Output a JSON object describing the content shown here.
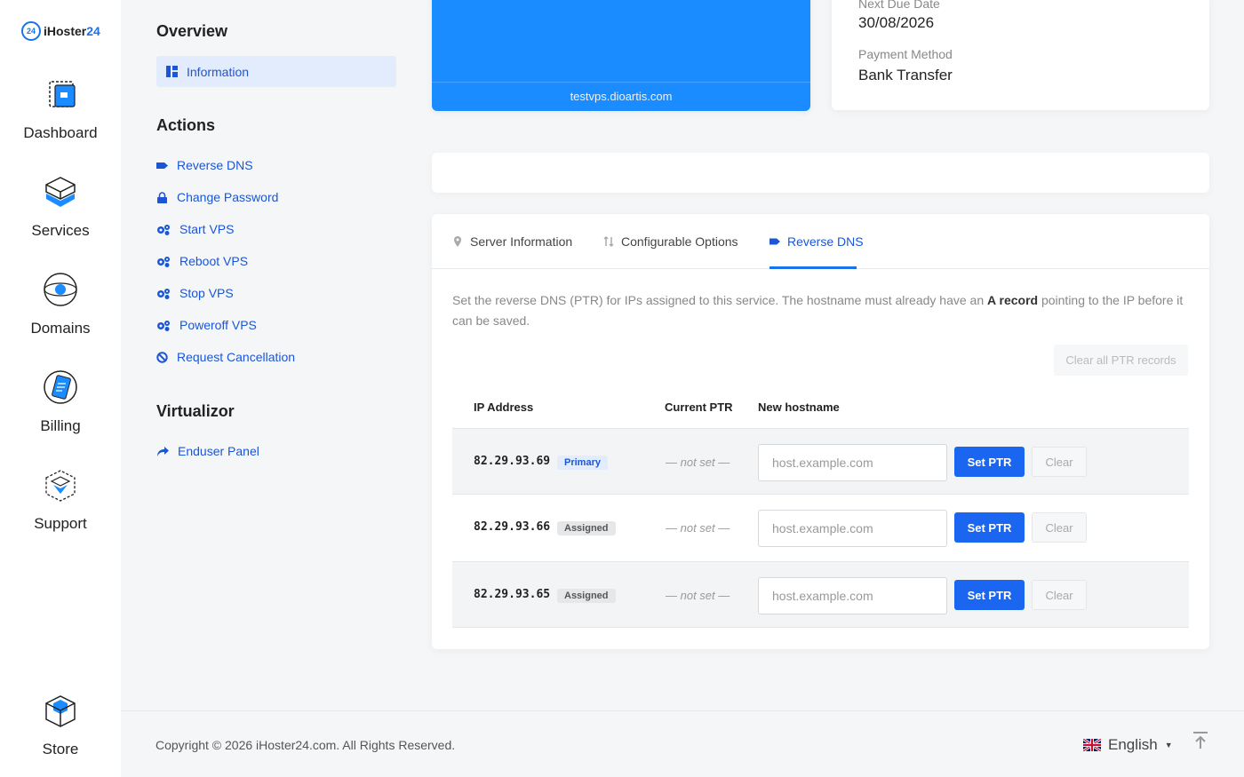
{
  "brand": {
    "badge": "24",
    "name_prefix": "iHoster",
    "name_suffix": "24"
  },
  "rail": {
    "items": [
      {
        "label": "Dashboard",
        "icon": "dashboard-icon"
      },
      {
        "label": "Services",
        "icon": "services-icon"
      },
      {
        "label": "Domains",
        "icon": "domains-icon"
      },
      {
        "label": "Billing",
        "icon": "billing-icon"
      },
      {
        "label": "Support",
        "icon": "support-icon"
      },
      {
        "label": "Store",
        "icon": "store-icon"
      }
    ]
  },
  "subnav": {
    "overview_title": "Overview",
    "information_label": "Information",
    "actions_title": "Actions",
    "actions": [
      {
        "label": "Reverse DNS",
        "icon": "tag-icon"
      },
      {
        "label": "Change Password",
        "icon": "lock-icon"
      },
      {
        "label": "Start VPS",
        "icon": "gears-icon"
      },
      {
        "label": "Reboot VPS",
        "icon": "gears-icon"
      },
      {
        "label": "Stop VPS",
        "icon": "gears-icon"
      },
      {
        "label": "Poweroff VPS",
        "icon": "gears-icon"
      },
      {
        "label": "Request Cancellation",
        "icon": "ban-icon"
      }
    ],
    "virtualizor_title": "Virtualizor",
    "enduser_label": "Enduser Panel"
  },
  "product_card": {
    "hostname": "testvps.dioartis.com"
  },
  "info_card": {
    "next_due_label": "Next Due Date",
    "next_due_value": "30/08/2026",
    "payment_label": "Payment Method",
    "payment_value": "Bank Transfer"
  },
  "tabs": [
    {
      "label": "Server Information",
      "icon": "map-pin-icon"
    },
    {
      "label": "Configurable Options",
      "icon": "sort-icon"
    },
    {
      "label": "Reverse DNS",
      "icon": "tag-icon",
      "active": true
    }
  ],
  "rdns": {
    "desc_before": "Set the reverse DNS (PTR) for IPs assigned to this service. The hostname must already have an ",
    "desc_bold": "A record",
    "desc_after": " pointing to the IP before it can be saved.",
    "clear_all_label": "Clear all PTR records",
    "headers": {
      "ip": "IP Address",
      "current_ptr": "Current PTR",
      "new_hostname": "New hostname"
    },
    "rows": [
      {
        "ip": "82.29.93.69",
        "badge": "Primary",
        "ptr": "— not set —",
        "placeholder": "host.example.com",
        "set_label": "Set PTR",
        "clear_label": "Clear"
      },
      {
        "ip": "82.29.93.66",
        "badge": "Assigned",
        "ptr": "— not set —",
        "placeholder": "host.example.com",
        "set_label": "Set PTR",
        "clear_label": "Clear"
      },
      {
        "ip": "82.29.93.65",
        "badge": "Assigned",
        "ptr": "— not set —",
        "placeholder": "host.example.com",
        "set_label": "Set PTR",
        "clear_label": "Clear"
      }
    ]
  },
  "footer": {
    "copyright": "Copyright © 2026 iHoster24.com. All Rights Reserved.",
    "language": "English"
  },
  "colors": {
    "accent": "#1a73e8",
    "card_blue": "#1a8cff",
    "button_blue": "#1a66f0",
    "active_bg": "#e2ecfd"
  }
}
